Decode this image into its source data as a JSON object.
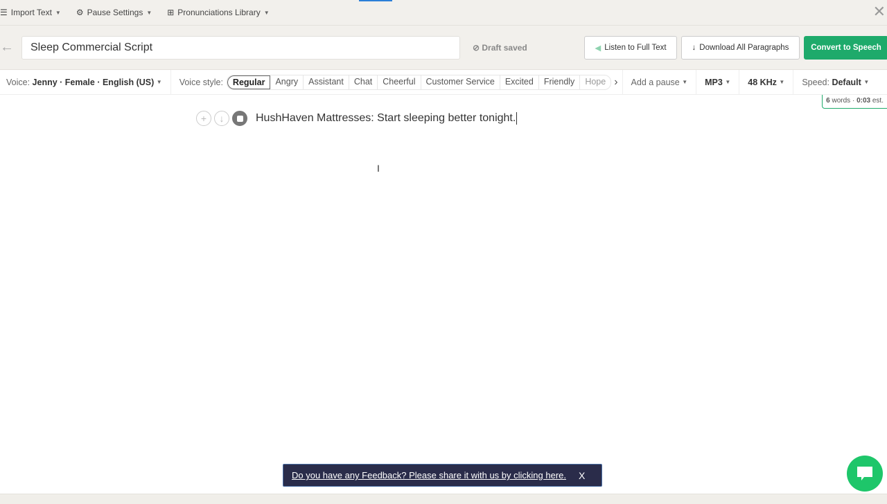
{
  "topbar": {
    "items": [
      {
        "label": "Import Text",
        "icon": "import-icon"
      },
      {
        "label": "Pause Settings",
        "icon": "gear-icon"
      },
      {
        "label": "Pronunciations Library",
        "icon": "grid-icon"
      }
    ]
  },
  "header": {
    "title": "Sleep Commercial Script",
    "draft_status": "Draft saved",
    "listen_label": "Listen to Full Text",
    "download_label": "Download All Paragraphs",
    "convert_label": "Convert to Speech"
  },
  "toolbar": {
    "voice_label": "Voice:",
    "voice_value": "Jenny · Female · English (US)",
    "style_label": "Voice style:",
    "styles": [
      "Regular",
      "Angry",
      "Assistant",
      "Chat",
      "Cheerful",
      "Customer Service",
      "Excited",
      "Friendly",
      "Hope"
    ],
    "active_style": "Regular",
    "pause_label": "Add a pause",
    "format": "MP3",
    "sample_rate": "48 KHz",
    "speed_label": "Speed:",
    "speed_value": "Default"
  },
  "stats": {
    "words": "6",
    "words_label": "words",
    "time": "0:03",
    "time_label": "est."
  },
  "editor": {
    "paragraphs": [
      "HushHaven Mattresses: Start sleeping better tonight."
    ]
  },
  "feedback": {
    "text": "Do you have any Feedback? Please share it with us by clicking here.",
    "close": "X"
  },
  "colors": {
    "accent": "#1eaa6b",
    "banner": "#2a2c4a",
    "chat": "#1ec66a"
  }
}
